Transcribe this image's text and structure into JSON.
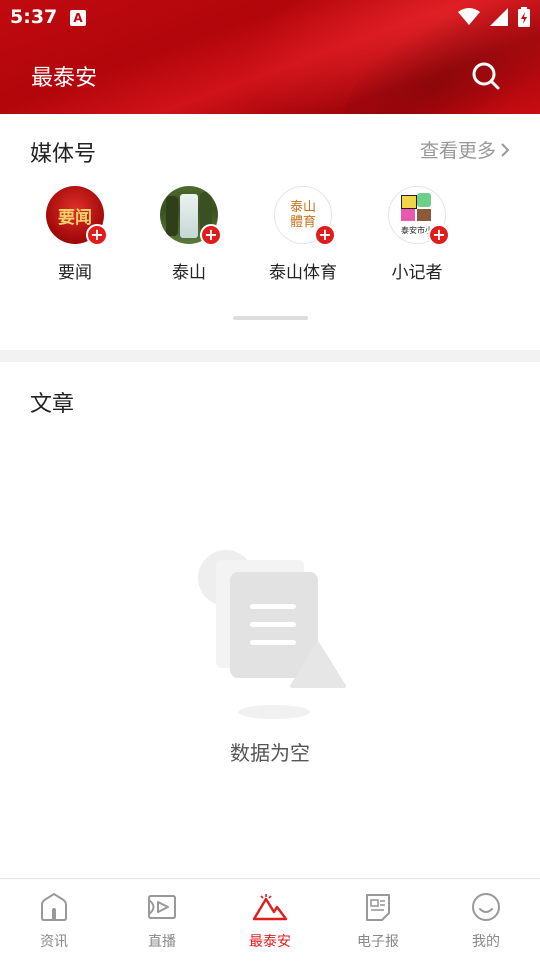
{
  "status_bar": {
    "time": "5:37",
    "notification_icon": "A"
  },
  "header": {
    "title": "最泰安",
    "search_icon": "search-icon"
  },
  "media_section": {
    "title": "媒体号",
    "more_label": "查看更多",
    "items": [
      {
        "label": "要闻",
        "avatar_text": "要闻"
      },
      {
        "label": "泰山",
        "avatar_text": ""
      },
      {
        "label": "泰山体育",
        "avatar_text": "泰山體育"
      },
      {
        "label": "小记者",
        "avatar_text": "泰安市小"
      }
    ]
  },
  "article_section": {
    "title": "文章",
    "empty_text": "数据为空"
  },
  "tabbar": {
    "items": [
      {
        "label": "资讯",
        "icon": "home-icon",
        "active": false
      },
      {
        "label": "直播",
        "icon": "live-icon",
        "active": false
      },
      {
        "label": "最泰安",
        "icon": "mountain-icon",
        "active": true
      },
      {
        "label": "电子报",
        "icon": "newspaper-icon",
        "active": false
      },
      {
        "label": "我的",
        "icon": "smile-icon",
        "active": false
      }
    ]
  },
  "colors": {
    "brand_red": "#c00a10",
    "accent_red": "#e01d1d",
    "muted": "#888888"
  }
}
